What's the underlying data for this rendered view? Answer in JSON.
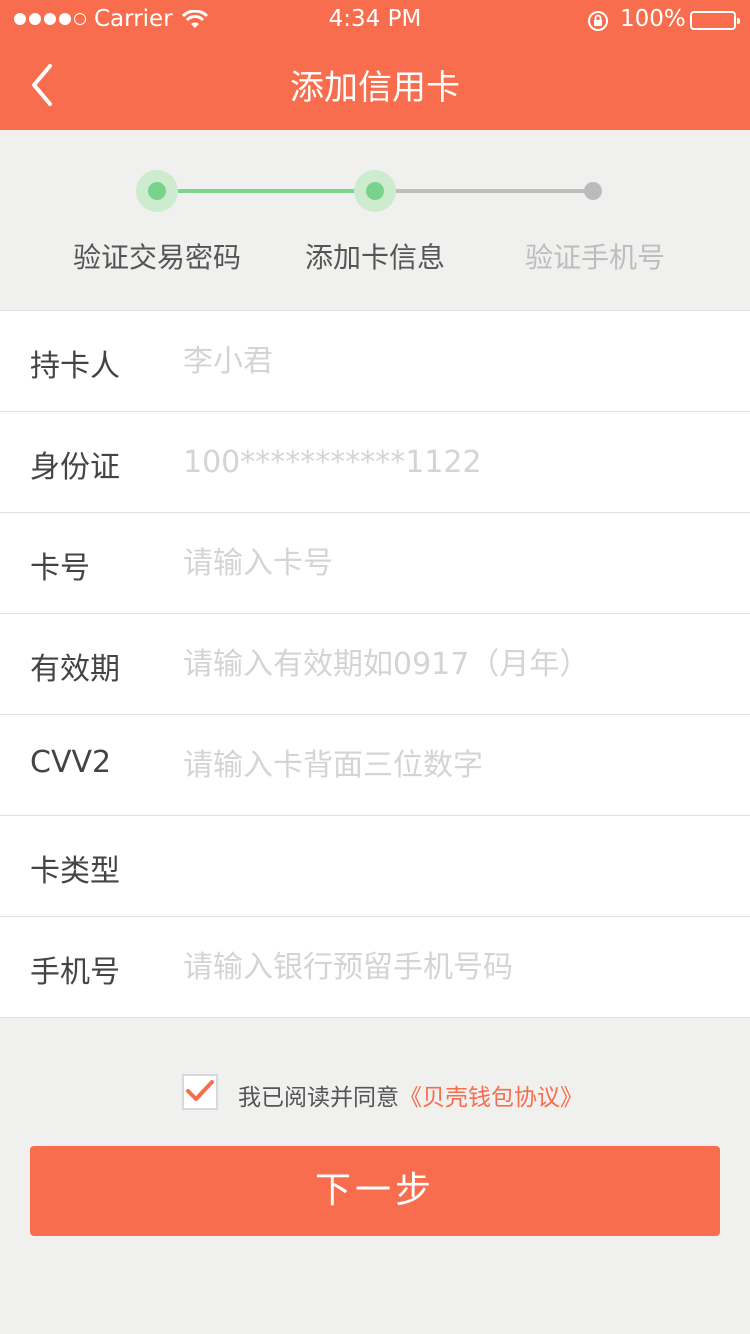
{
  "status_bar": {
    "carrier": "Carrier",
    "time": "4:34 PM",
    "battery_percent": "100%",
    "signal_bars_filled": 4,
    "signal_bars_total": 5
  },
  "nav": {
    "title": "添加信用卡",
    "back_icon": "chevron-left-icon"
  },
  "steps": {
    "items": [
      {
        "label": "验证交易密码",
        "state": "done"
      },
      {
        "label": "添加卡信息",
        "state": "current"
      },
      {
        "label": "验证手机号",
        "state": "pending"
      }
    ]
  },
  "form": {
    "rows": [
      {
        "label": "持卡人",
        "value": "",
        "placeholder": "李小君"
      },
      {
        "label": "身份证",
        "value": "",
        "placeholder": "100***********1122"
      },
      {
        "label": "卡号",
        "value": "",
        "placeholder": "请输入卡号"
      },
      {
        "label": "有效期",
        "value": "",
        "placeholder": "请输入有效期如0917（月年）"
      },
      {
        "label": "CVV2",
        "value": "",
        "placeholder": "请输入卡背面三位数字"
      },
      {
        "label": "卡类型",
        "value": "",
        "placeholder": ""
      },
      {
        "label": "手机号",
        "value": "",
        "placeholder": "请输入银行预留手机号码"
      }
    ]
  },
  "agreement": {
    "checked": true,
    "text": "我已阅读并同意",
    "link_text": "《贝壳钱包协议》"
  },
  "next_button": {
    "label": "下一步"
  },
  "colors": {
    "accent": "#f76d4d",
    "step_done": "#79d38a",
    "step_pending": "#bbbbbb",
    "background": "#f0f0ee"
  }
}
